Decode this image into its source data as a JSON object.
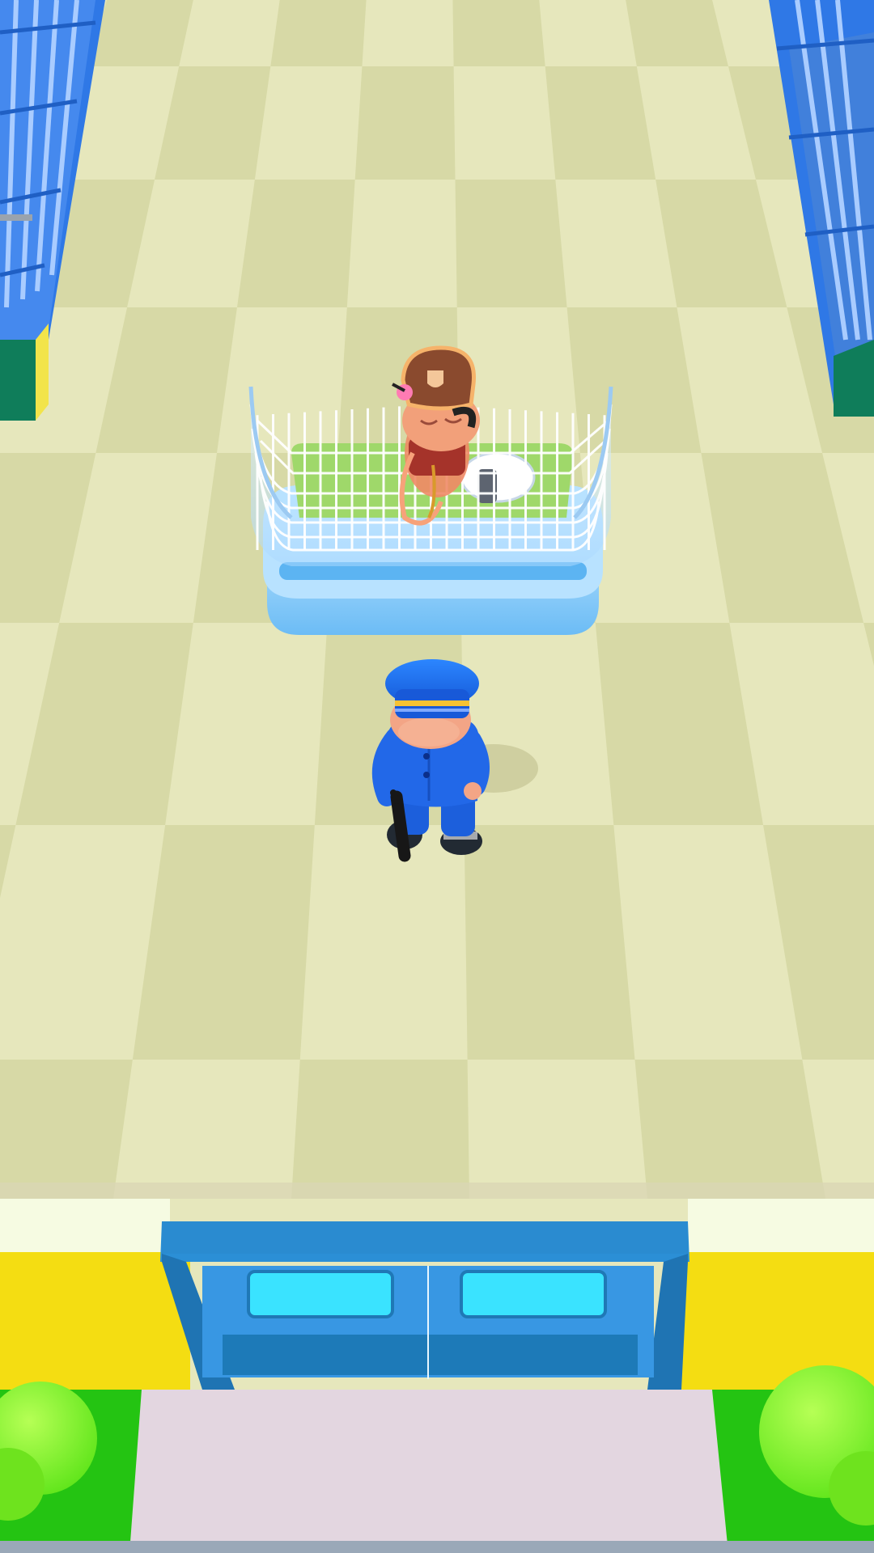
{
  "scene": {
    "title": "",
    "colors": {
      "floor_light": "#e6e7bc",
      "floor_dark": "#d7d9a6",
      "wall_blue": "#2f78e6",
      "bars_light": "#7aaef7",
      "door_frame": "#2a8bd0",
      "door_panel": "#1d7ab8",
      "door_window": "#3ae3ff",
      "wall_yellow": "#f4dd12",
      "ledge": "#f6fbe2",
      "grass": "#24c412",
      "bush": "#86ff22",
      "path": "#e3d6e0",
      "uniform": "#1e64e6",
      "cell_glass": "#cfe9ff",
      "cell_base": "#8fd0ff",
      "prisoner_hat": "#8a4a2e",
      "skin": "#f2a07a"
    },
    "icons": {
      "guard": "police-officer-icon",
      "prisoner": "prisoner-icon",
      "cell": "holding-cell-icon",
      "door": "double-door-icon"
    }
  }
}
